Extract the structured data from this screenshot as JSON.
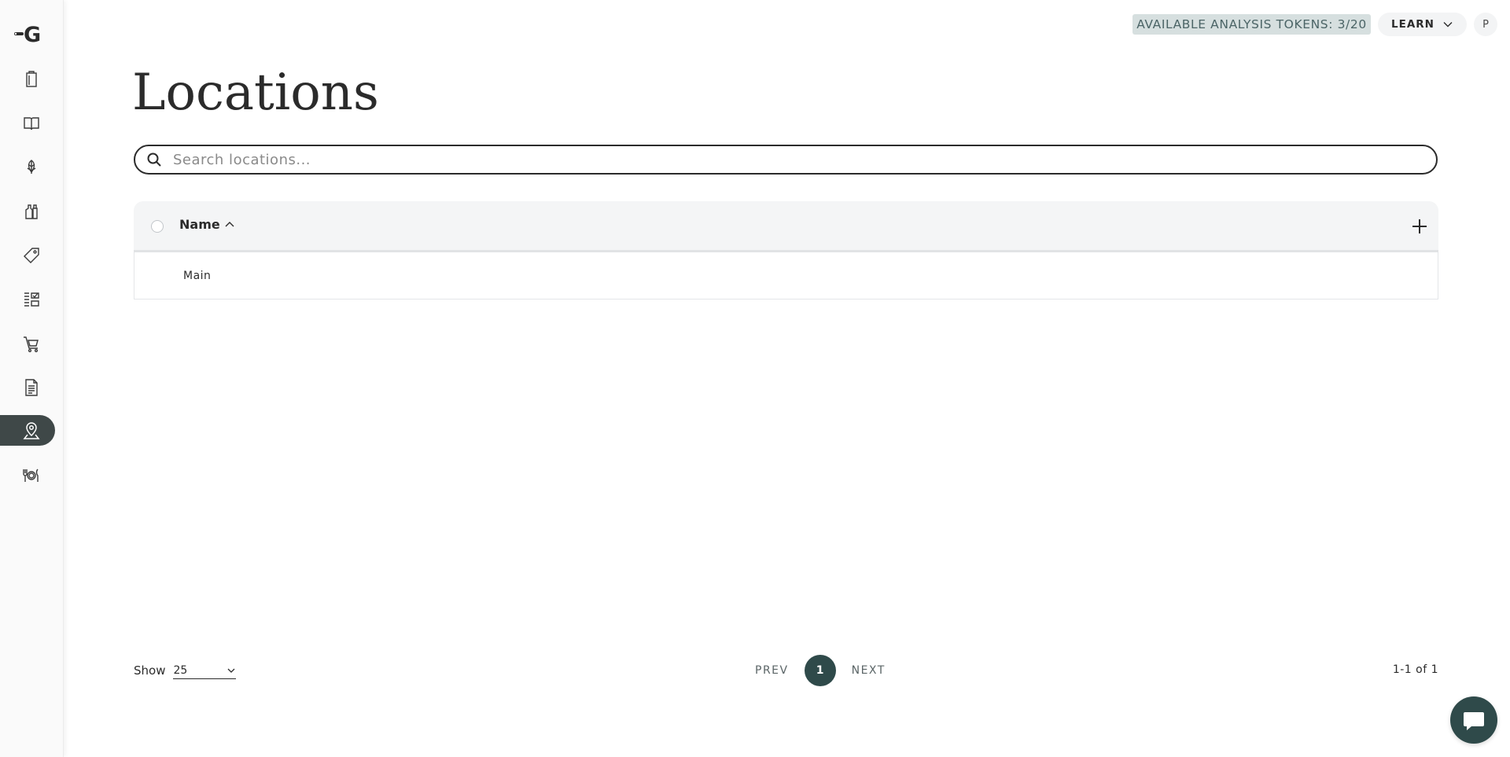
{
  "header": {
    "tokens_label": "AVAILABLE ANALYSIS TOKENS: 3/20",
    "learn_label": "LEARN",
    "avatar_initial": "P"
  },
  "sidebar": {
    "items": [
      {
        "icon": "clipboard-icon"
      },
      {
        "icon": "book-icon"
      },
      {
        "icon": "hop-icon"
      },
      {
        "icon": "bottles-icon"
      },
      {
        "icon": "tag-icon"
      },
      {
        "icon": "checklist-icon"
      },
      {
        "icon": "cart-icon"
      },
      {
        "icon": "document-icon"
      },
      {
        "icon": "location-icon",
        "active": true
      },
      {
        "icon": "dining-icon"
      }
    ],
    "active_color": "#3f4848"
  },
  "page": {
    "title": "Locations"
  },
  "search": {
    "placeholder": "Search locations...",
    "value": ""
  },
  "table": {
    "columns": [
      "Name"
    ],
    "sort": "ascending",
    "rows": [
      {
        "name": "Main"
      }
    ]
  },
  "footer": {
    "show_label": "Show",
    "page_size": "25",
    "prev_label": "PREV",
    "current_page": "1",
    "next_label": "NEXT",
    "count_label": "1-1 of 1"
  },
  "colors": {
    "accent": "#2f4a4a",
    "tokens_bg": "#d6dfdf"
  }
}
